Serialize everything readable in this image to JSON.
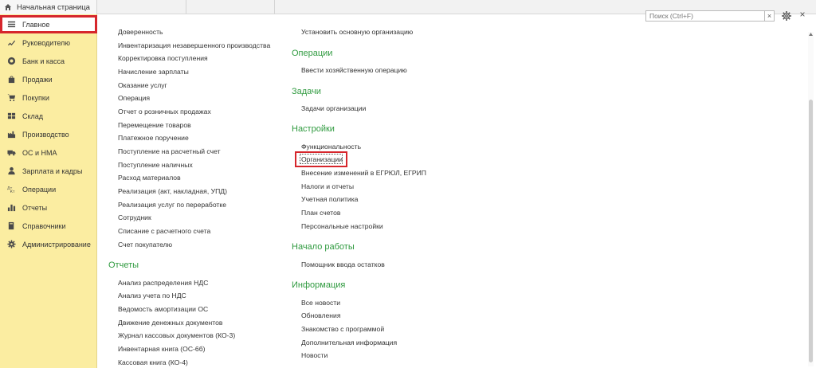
{
  "tabs": {
    "home_label": "Начальная страница"
  },
  "sidebar": {
    "items": [
      {
        "label": "Главное",
        "icon": "menu-lines-icon"
      },
      {
        "label": "Руководителю",
        "icon": "trend-icon"
      },
      {
        "label": "Банк и касса",
        "icon": "coins-icon"
      },
      {
        "label": "Продажи",
        "icon": "bag-icon"
      },
      {
        "label": "Покупки",
        "icon": "cart-icon"
      },
      {
        "label": "Склад",
        "icon": "warehouse-icon"
      },
      {
        "label": "Производство",
        "icon": "factory-icon"
      },
      {
        "label": "ОС и НМА",
        "icon": "truck-icon"
      },
      {
        "label": "Зарплата и кадры",
        "icon": "person-icon"
      },
      {
        "label": "Операции",
        "icon": "operations-icon"
      },
      {
        "label": "Отчеты",
        "icon": "bar-chart-icon"
      },
      {
        "label": "Справочники",
        "icon": "books-icon"
      },
      {
        "label": "Администрирование",
        "icon": "gear-icon"
      }
    ]
  },
  "col1": {
    "links_top": [
      "Доверенность",
      "Инвентаризация незавершенного производства",
      "Корректировка поступления",
      "Начисление зарплаты",
      "Оказание услуг",
      "Операция",
      "Отчет о розничных продажах",
      "Перемещение товаров",
      "Платежное поручение",
      "Поступление на расчетный счет",
      "Поступление наличных",
      "Расход материалов",
      "Реализация (акт, накладная, УПД)",
      "Реализация услуг по переработке",
      "Сотрудник",
      "Списание с расчетного счета",
      "Счет покупателю"
    ],
    "reports_title": "Отчеты",
    "reports": [
      "Анализ распределения НДС",
      "Анализ учета по НДС",
      "Ведомость амортизации ОС",
      "Движение денежных документов",
      "Журнал кассовых документов (КО-3)",
      "Инвентарная книга (ОС-6б)",
      "Кассовая книга (КО-4)"
    ]
  },
  "col2": {
    "top_link": "Установить основную организацию",
    "operations_title": "Операции",
    "operations": [
      "Ввести хозяйственную операцию"
    ],
    "tasks_title": "Задачи",
    "tasks": [
      "Задачи организации"
    ],
    "settings_title": "Настройки",
    "settings": [
      "Функциональность",
      "Организации",
      "Внесение изменений в ЕГРЮЛ, ЕГРИП",
      "Налоги и отчеты",
      "Учетная политика",
      "План счетов",
      "Персональные настройки"
    ],
    "start_title": "Начало работы",
    "start": [
      "Помощник ввода остатков"
    ],
    "info_title": "Информация",
    "info": [
      "Все новости",
      "Обновления",
      "Знакомство с программой",
      "Дополнительная информация",
      "Новости"
    ]
  },
  "search": {
    "placeholder": "Поиск (Ctrl+F)",
    "clear": "×"
  },
  "window": {
    "close": "×"
  },
  "colors": {
    "sidebar_bg": "#fbeda1",
    "section_green": "#2f9a3f",
    "highlight_red": "#d6262c"
  }
}
